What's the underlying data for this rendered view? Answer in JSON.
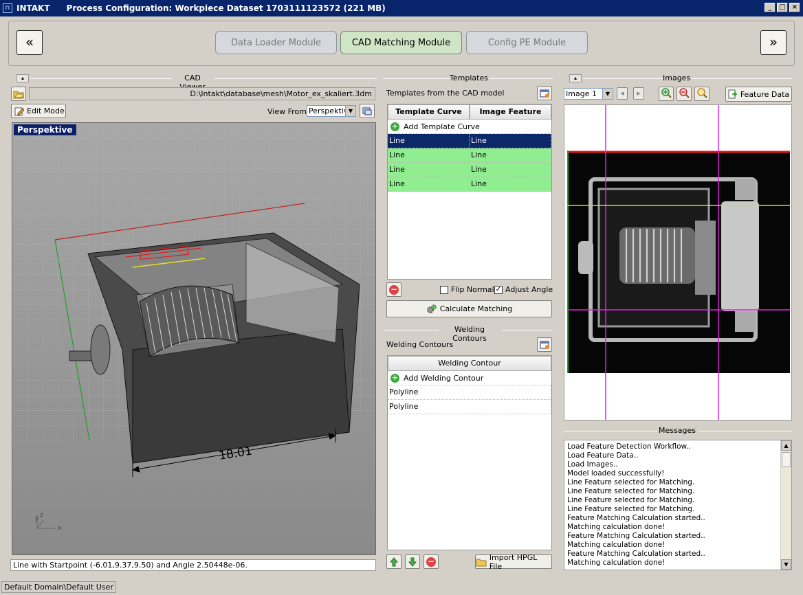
{
  "window": {
    "app_name": "INTAKT",
    "title": "Process Configuration:  Workpiece Dataset 1703111123572    (221 MB)"
  },
  "nav": {
    "prev_symbol": "«",
    "next_symbol": "»",
    "tabs": [
      {
        "label": "Data Loader Module",
        "active": false
      },
      {
        "label": "CAD Matching Module",
        "active": true
      },
      {
        "label": "Config PE Module",
        "active": false
      }
    ]
  },
  "cad_viewer": {
    "title": "CAD Viewer",
    "path": "D:\\Intakt\\database\\mesh\\Motor_ex_skaliert.3dm",
    "edit_mode_label": "Edit Mode",
    "view_from_label": "View From:",
    "view_from_value": "Perspektiv",
    "viewport_label": "Perspektive",
    "dimension_label": "18.01",
    "axis_z": "z",
    "axis_y": "y",
    "axis_x": "x",
    "status_text": "Line with Startpoint (-6.01,9.37,9.50) and Angle 2.50448e-06."
  },
  "templates": {
    "title": "Templates",
    "subtitle": "Templates from the CAD model",
    "columns": [
      "Template Curve",
      "Image Feature"
    ],
    "add_label": "Add Template Curve",
    "rows": [
      {
        "curve": "Line",
        "feature": "Line",
        "state": "selected"
      },
      {
        "curve": "Line",
        "feature": "Line",
        "state": "matched"
      },
      {
        "curve": "Line",
        "feature": "Line",
        "state": "matched"
      },
      {
        "curve": "Line",
        "feature": "Line",
        "state": "matched"
      }
    ],
    "flip_normal_label": "Flip Normal",
    "flip_normal_checked": false,
    "adjust_angle_label": "Adjust Angle",
    "adjust_angle_checked": true,
    "calculate_label": "Calculate Matching"
  },
  "welding": {
    "title": "Welding Contours",
    "subtitle": "Welding Contours",
    "column": "Welding Contour",
    "add_label": "Add Welding Contour",
    "rows": [
      "Polyline",
      "Polyline"
    ],
    "import_label": "Import HPGL File"
  },
  "images": {
    "title": "Images",
    "selected_image": "Image 1",
    "feature_data_label": "Feature Data"
  },
  "messages": {
    "title": "Messages",
    "lines": [
      "Load Feature Detection Workflow..",
      "Load Feature Data..",
      "Load Images..",
      "Model loaded successfully!",
      "Line Feature selected for Matching.",
      "Line Feature selected for Matching.",
      "Line Feature selected for Matching.",
      "Line Feature selected for Matching.",
      "Feature Matching Calculation started..",
      "Matching calculation done!",
      "Feature Matching Calculation started..",
      "Matching calculation done!",
      "Feature Matching Calculation started..",
      "Matching calculation done!"
    ]
  },
  "status_bar": {
    "user": "Default Domain\\Default User"
  },
  "colors": {
    "title_bar": "#08246b",
    "selected_row": "#0d2868",
    "matched_row": "#90ee90",
    "active_tab": "#cfe5c6"
  }
}
